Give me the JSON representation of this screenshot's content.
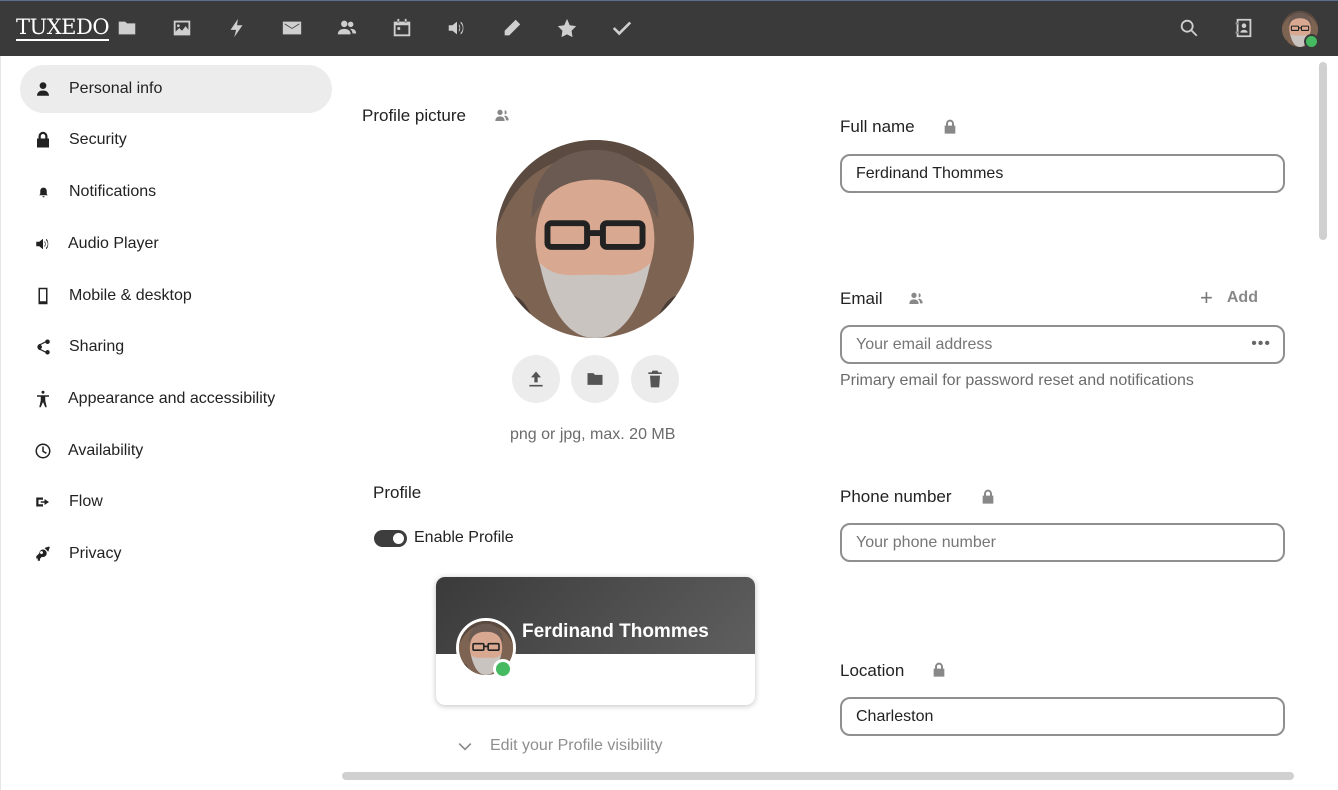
{
  "header": {
    "logo": "TUXEDO",
    "apps": [
      {
        "name": "files-icon"
      },
      {
        "name": "photos-icon"
      },
      {
        "name": "activity-icon"
      },
      {
        "name": "mail-icon"
      },
      {
        "name": "contacts-icon"
      },
      {
        "name": "calendar-icon"
      },
      {
        "name": "audio-icon"
      },
      {
        "name": "notes-icon"
      },
      {
        "name": "favorites-icon"
      },
      {
        "name": "tasks-icon"
      }
    ],
    "right_icons": [
      "search-icon",
      "contacts-menu-icon",
      "user-avatar"
    ]
  },
  "sidebar": {
    "items": [
      {
        "label": "Personal info",
        "icon": "user-icon",
        "active": true
      },
      {
        "label": "Security",
        "icon": "lock-icon"
      },
      {
        "label": "Notifications",
        "icon": "bell-icon"
      },
      {
        "label": "Audio Player",
        "icon": "speaker-icon"
      },
      {
        "label": "Mobile & desktop",
        "icon": "phone-icon"
      },
      {
        "label": "Sharing",
        "icon": "share-icon"
      },
      {
        "label": "Appearance and accessibility",
        "icon": "accessibility-icon"
      },
      {
        "label": "Availability",
        "icon": "clock-icon"
      },
      {
        "label": "Flow",
        "icon": "flow-icon"
      },
      {
        "label": "Privacy",
        "icon": "key-icon"
      }
    ]
  },
  "profile_picture": {
    "title": "Profile picture",
    "hint": "png or jpg, max. 20 MB"
  },
  "profile": {
    "title": "Profile",
    "enable_label": "Enable Profile",
    "enabled": true,
    "card_name": "Ferdinand Thommes",
    "visibility_link": "Edit your Profile visibility"
  },
  "fields": {
    "full_name": {
      "label": "Full name",
      "value": "Ferdinand Thommes"
    },
    "email": {
      "label": "Email",
      "placeholder": "Your email address",
      "add_label": "Add",
      "helper": "Primary email for password reset and notifications"
    },
    "phone": {
      "label": "Phone number",
      "placeholder": "Your phone number"
    },
    "location": {
      "label": "Location",
      "value": "Charleston"
    }
  },
  "colors": {
    "header_bg": "#3a3a3a",
    "status_online": "#46ba61",
    "active_nav_bg": "#ececec"
  }
}
